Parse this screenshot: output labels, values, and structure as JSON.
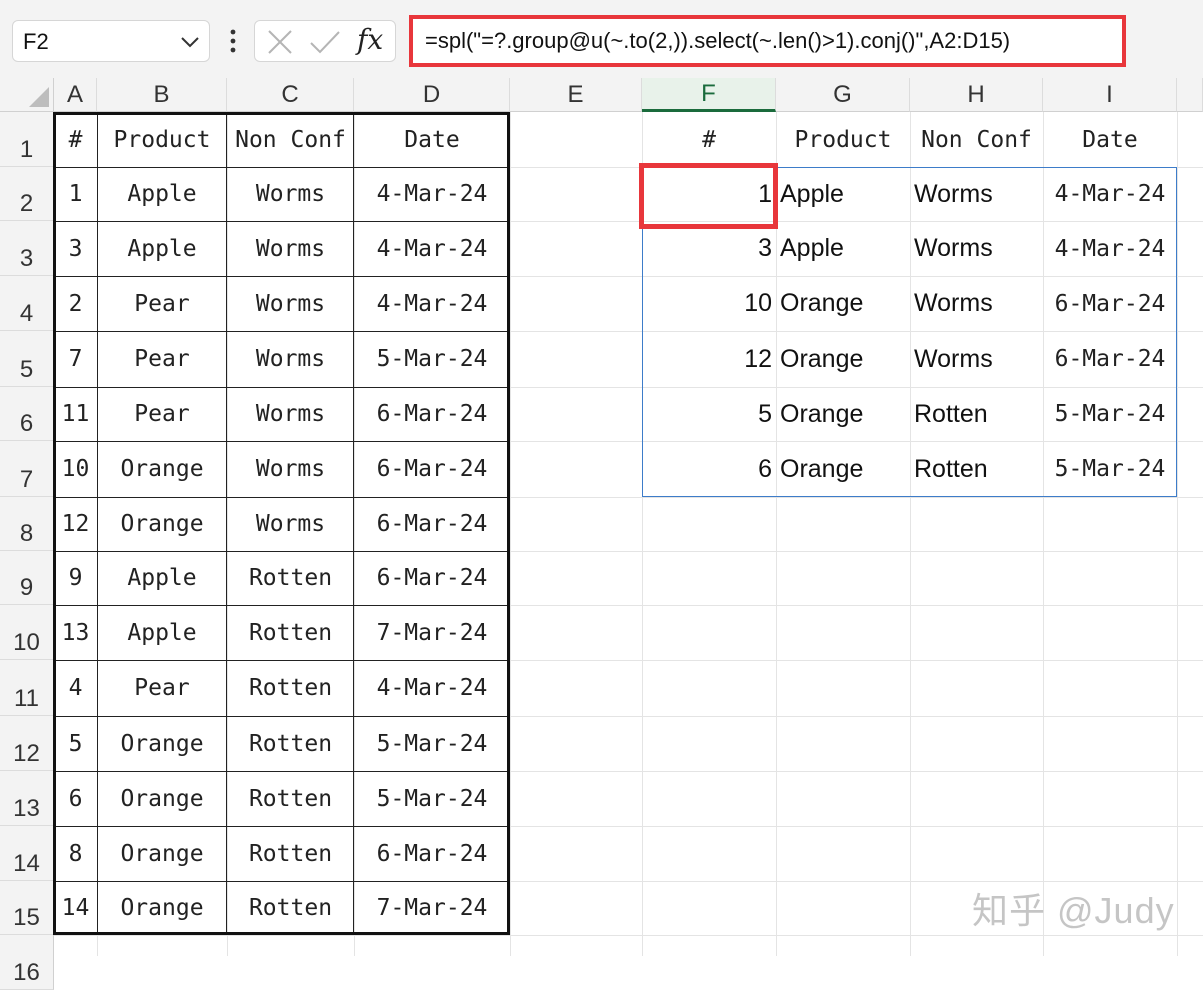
{
  "name_box": {
    "value": "F2"
  },
  "formula_bar": {
    "fx_label": "fx",
    "formula": "=spl(\"=?.group@u(~.to(2,)).select(~.len()>1).conj()\",A2:D15)"
  },
  "columns": [
    "A",
    "B",
    "C",
    "D",
    "E",
    "F",
    "G",
    "H",
    "I"
  ],
  "rows": [
    "1",
    "2",
    "3",
    "4",
    "5",
    "6",
    "7",
    "8",
    "9",
    "10",
    "11",
    "12",
    "13",
    "14",
    "15",
    "16"
  ],
  "source_table": {
    "headers": [
      "#",
      "Product",
      "Non Conf",
      "Date"
    ],
    "rows": [
      [
        "1",
        "Apple",
        "Worms",
        "4-Mar-24"
      ],
      [
        "3",
        "Apple",
        "Worms",
        "4-Mar-24"
      ],
      [
        "2",
        "Pear",
        "Worms",
        "4-Mar-24"
      ],
      [
        "7",
        "Pear",
        "Worms",
        "5-Mar-24"
      ],
      [
        "11",
        "Pear",
        "Worms",
        "6-Mar-24"
      ],
      [
        "10",
        "Orange",
        "Worms",
        "6-Mar-24"
      ],
      [
        "12",
        "Orange",
        "Worms",
        "6-Mar-24"
      ],
      [
        "9",
        "Apple",
        "Rotten",
        "6-Mar-24"
      ],
      [
        "13",
        "Apple",
        "Rotten",
        "7-Mar-24"
      ],
      [
        "4",
        "Pear",
        "Rotten",
        "4-Mar-24"
      ],
      [
        "5",
        "Orange",
        "Rotten",
        "5-Mar-24"
      ],
      [
        "6",
        "Orange",
        "Rotten",
        "5-Mar-24"
      ],
      [
        "8",
        "Orange",
        "Rotten",
        "6-Mar-24"
      ],
      [
        "14",
        "Orange",
        "Rotten",
        "7-Mar-24"
      ]
    ]
  },
  "result_table": {
    "headers": [
      "#",
      "Product",
      "Non Conf",
      "Date"
    ],
    "rows": [
      [
        "1",
        "Apple",
        "Worms",
        "4-Mar-24"
      ],
      [
        "3",
        "Apple",
        "Worms",
        "4-Mar-24"
      ],
      [
        "10",
        "Orange",
        "Worms",
        "6-Mar-24"
      ],
      [
        "12",
        "Orange",
        "Worms",
        "6-Mar-24"
      ],
      [
        "5",
        "Orange",
        "Rotten",
        "5-Mar-24"
      ],
      [
        "6",
        "Orange",
        "Rotten",
        "5-Mar-24"
      ]
    ]
  },
  "watermark": "知乎 @Judy",
  "colors": {
    "highlight_red": "#e8363b",
    "selection_blue": "#3d7cc9",
    "active_header_green": "#1a6b3c"
  }
}
